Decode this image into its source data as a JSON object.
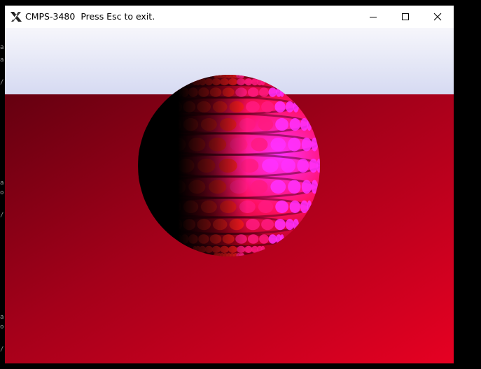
{
  "window": {
    "title": "CMPS-3480",
    "subtitle": "Press Esc to exit.",
    "icon": "x-window-system-icon",
    "controls": [
      "minimize-icon",
      "maximize-icon",
      "close-icon"
    ]
  },
  "background_terminal": {
    "fragments": [
      "a",
      "a",
      "/",
      "a",
      "o",
      "/",
      "a",
      "o",
      "/"
    ]
  },
  "scene": {
    "sky_colors": [
      "#f4f4fa",
      "#d8dcf2"
    ],
    "floor_colors": [
      "#6b0010",
      "#e00021"
    ],
    "sphere_colors": [
      "#000000",
      "#ff1818",
      "#ff20ff"
    ]
  }
}
